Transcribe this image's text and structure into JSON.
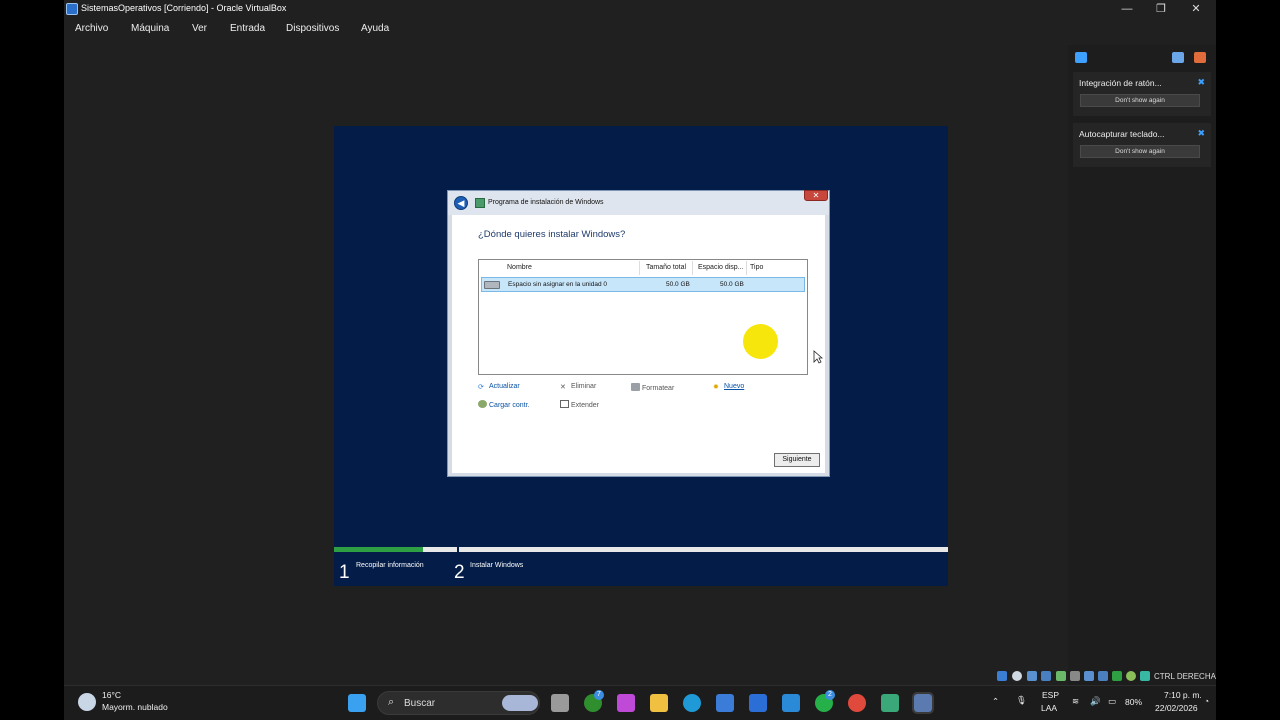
{
  "window": {
    "title": "SistemasOperativos [Corriendo] - Oracle VirtualBox",
    "minimize": "—",
    "maximize": "❐",
    "close": "✕"
  },
  "menu": [
    "Archivo",
    "Máquina",
    "Ver",
    "Entrada",
    "Dispositivos",
    "Ayuda"
  ],
  "setup": {
    "title": "Programa de instalación de Windows",
    "heading": "¿Dónde quieres instalar Windows?",
    "columns": [
      "Nombre",
      "Tamaño total",
      "Espacio disp...",
      "Tipo"
    ],
    "rows": [
      {
        "name": "Espacio sin asignar en la unidad 0",
        "total": "50.0 GB",
        "free": "50.0 GB",
        "type": ""
      }
    ],
    "actions": {
      "refresh": "Actualizar",
      "delete": "Eliminar",
      "format": "Formatear",
      "new": "Nuevo",
      "load": "Cargar contr.",
      "extend": "Extender"
    },
    "next": "Siguiente",
    "steps": [
      {
        "num": "1",
        "label": "Recopilar información"
      },
      {
        "num": "2",
        "label": "Instalar Windows"
      }
    ]
  },
  "notifications": [
    {
      "title": "Integración de ratón...",
      "button": "Don't show again"
    },
    {
      "title": "Autocapturar teclado...",
      "button": "Don't show again"
    }
  ],
  "statusbar": {
    "host_key": "CTRL DERECHA"
  },
  "taskbar": {
    "weather_temp": "16°C",
    "weather_desc": "Mayorm. nublado",
    "search_placeholder": "Buscar",
    "xbox_badge": "7",
    "outlook_badge": "2",
    "lang": "ESP",
    "layout": "LAA",
    "battery": "80%",
    "time": "7:10 p. m.",
    "date": "22/02/2026"
  },
  "colors": {
    "vm_background": "#031c48",
    "progress_done": "#2ea043",
    "cursor_highlight": "#f6e60c",
    "link": "#0a52a5"
  }
}
